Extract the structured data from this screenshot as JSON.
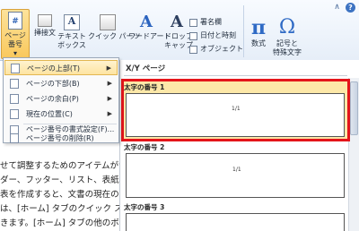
{
  "ribbon": {
    "page_number_label_1": "ページ",
    "page_number_label_2": "番号",
    "textbox_label_1": "テキスト",
    "textbox_label_2": "ボックス",
    "insert_text_label": "挿接文",
    "quickparts_label": "クイック パーツ",
    "wordart_label": "ワードアート",
    "dropcap_label_1": "ドロップ",
    "dropcap_label_2": "キャップ",
    "signature_label": "署名欄",
    "datetime_label": "日付と時刻",
    "object_label": "オブジェクト",
    "equation_label": "数式",
    "symbol_label_1": "記号と",
    "symbol_label_2": "特殊文字"
  },
  "menu": {
    "items": [
      {
        "label": "ページの上部(T)"
      },
      {
        "label": "ページの下部(B)"
      },
      {
        "label": "ページの余白(P)"
      },
      {
        "label": "現在の位置(C)"
      },
      {
        "label": "ページ番号の書式設定(F)..."
      },
      {
        "label": "ページ番号の削除(R)"
      }
    ]
  },
  "gallery": {
    "category": "X/Y ページ",
    "items": [
      {
        "label": "太字の番号 1",
        "preview_text": "1/1"
      },
      {
        "label": "太字の番号 2",
        "preview_text": "1/1"
      },
      {
        "label": "太字の番号 3",
        "preview_text": ""
      }
    ]
  },
  "document": {
    "lines": [
      "せて調整するためのアイテムが含",
      "ダー、フッター、リスト、表紙や",
      "表を作成すると、文書の現在の体",
      "は、[ホーム] タブのクイック ス",
      "きます。[ホーム] タブの他のボタ"
    ]
  },
  "colors": {
    "highlight_frame": "#e4151a",
    "selected_item_bg": "#fde8a8",
    "page_number_button": "#f9c85d"
  }
}
